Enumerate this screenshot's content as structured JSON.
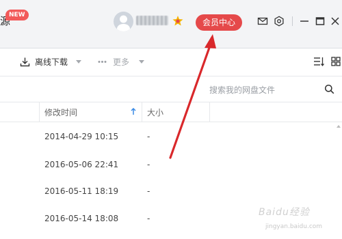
{
  "titlebar": {
    "source_text": "源",
    "new_badge": "NEW",
    "vip_button": "会员中心"
  },
  "toolbar": {
    "offline_download": "离线下载",
    "more": "更多"
  },
  "search": {
    "placeholder": "搜索我的网盘文件"
  },
  "columns": {
    "modified": "修改时间",
    "size": "大小"
  },
  "rows": [
    {
      "modified": "2014-04-29 10:15",
      "size": "-"
    },
    {
      "modified": "2016-05-06 22:41",
      "size": "-"
    },
    {
      "modified": "2016-05-11 18:19",
      "size": "-"
    },
    {
      "modified": "2016-05-14 18:08",
      "size": "-"
    }
  ],
  "watermark": {
    "logo": "Baidu经验",
    "url": "jingyan.baidu.com"
  },
  "colors": {
    "accent": "#e5494a",
    "annotation_arrow": "#d9282b",
    "sort_arrow": "#3b8be6"
  },
  "icons": [
    "download-icon",
    "more-dots-icon",
    "mail-icon",
    "settings-icon",
    "minimize-icon",
    "maximize-icon",
    "close-icon",
    "sort-icon",
    "grid-view-icon",
    "search-icon",
    "sort-arrow-up-icon",
    "vip-crown-icon"
  ]
}
